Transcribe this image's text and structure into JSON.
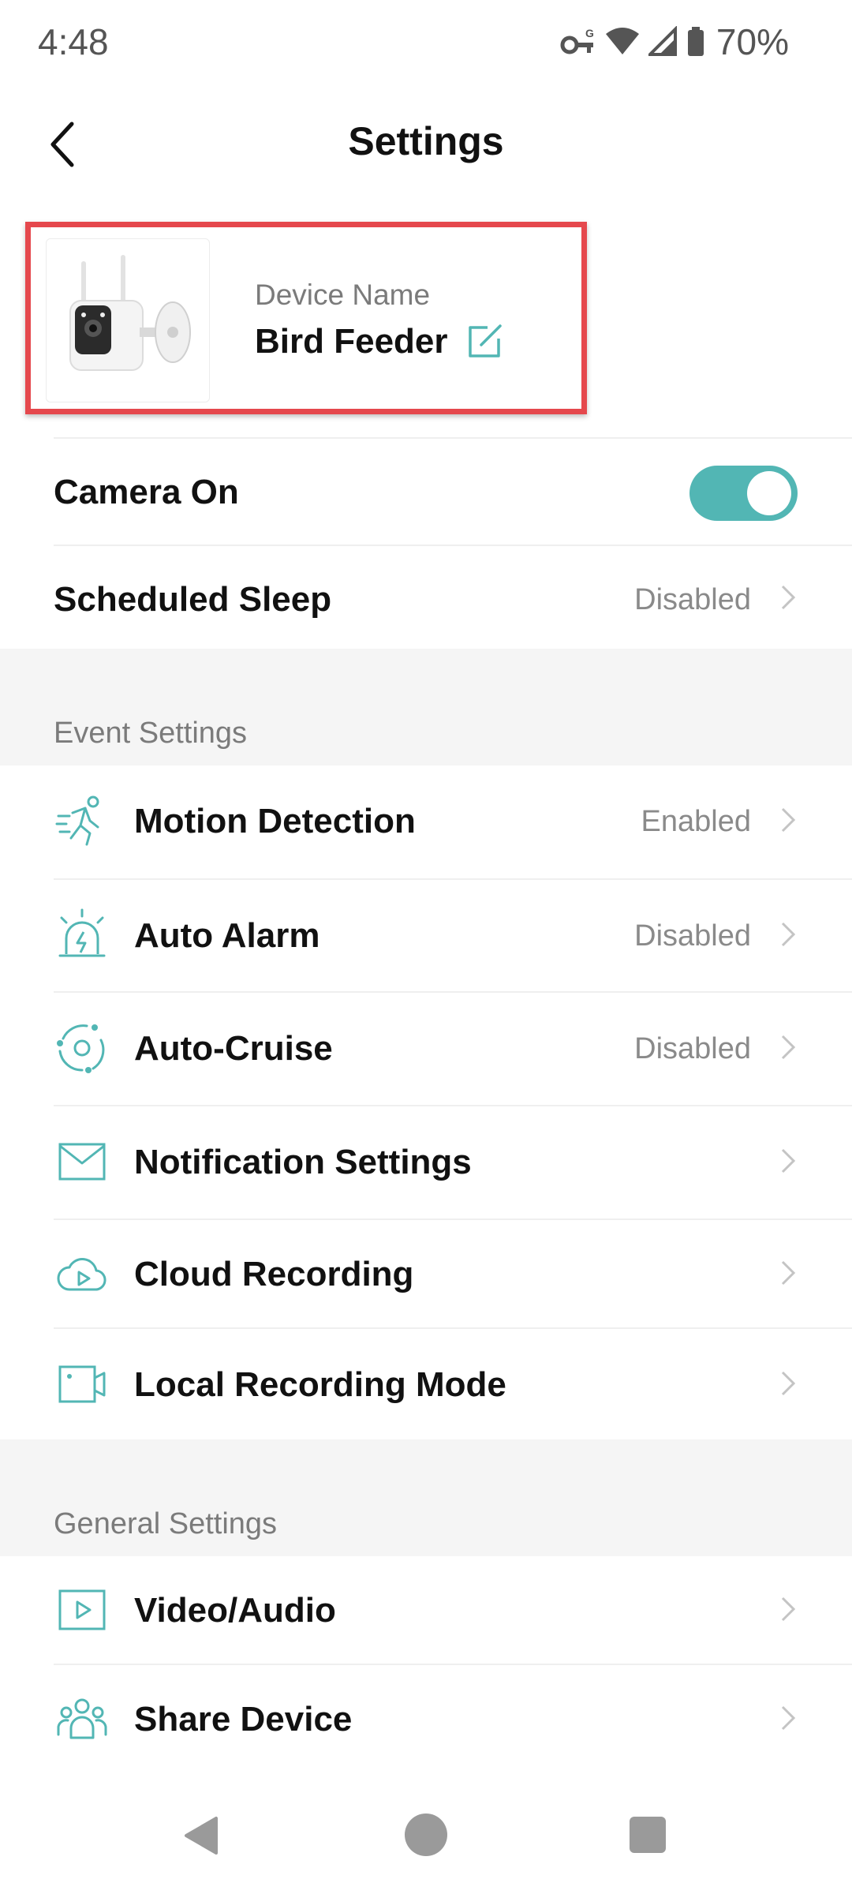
{
  "status_bar": {
    "time": "4:48",
    "battery": "70%"
  },
  "header": {
    "title": "Settings"
  },
  "device": {
    "label": "Device Name",
    "name": "Bird Feeder"
  },
  "top_rows": [
    {
      "label": "Camera On",
      "toggle_on": true
    },
    {
      "label": "Scheduled Sleep",
      "value": "Disabled"
    }
  ],
  "event_settings": {
    "title": "Event Settings",
    "items": [
      {
        "label": "Motion Detection",
        "value": "Enabled",
        "icon": "running-person-icon"
      },
      {
        "label": "Auto Alarm",
        "value": "Disabled",
        "icon": "alarm-siren-icon"
      },
      {
        "label": "Auto-Cruise",
        "value": "Disabled",
        "icon": "cruise-orbit-icon"
      },
      {
        "label": "Notification Settings",
        "icon": "envelope-icon"
      },
      {
        "label": "Cloud Recording",
        "icon": "cloud-play-icon"
      },
      {
        "label": "Local Recording Mode",
        "icon": "video-camera-icon"
      }
    ]
  },
  "general_settings": {
    "title": "General Settings",
    "items": [
      {
        "label": "Video/Audio",
        "icon": "video-play-icon"
      },
      {
        "label": "Share Device",
        "icon": "people-icon"
      }
    ]
  },
  "colors": {
    "accent": "#52b6b4",
    "highlight": "#e5484d",
    "section_bg": "#f5f5f5"
  }
}
